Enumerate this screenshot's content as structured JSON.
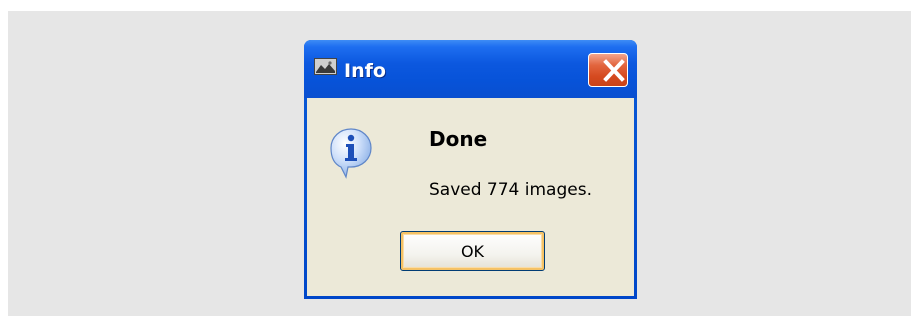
{
  "dialog": {
    "title": "Info",
    "heading": "Done",
    "message": "Saved 774 images.",
    "ok_label": "OK"
  },
  "icons": {
    "app": "app-image-icon",
    "close": "close-icon",
    "info": "info-icon"
  },
  "colors": {
    "titlebar": "#0a58de",
    "close_button": "#d9552c",
    "dialog_background": "#ece9d8",
    "backdrop": "#e6e6e6",
    "ok_focus": "#f5c265"
  }
}
